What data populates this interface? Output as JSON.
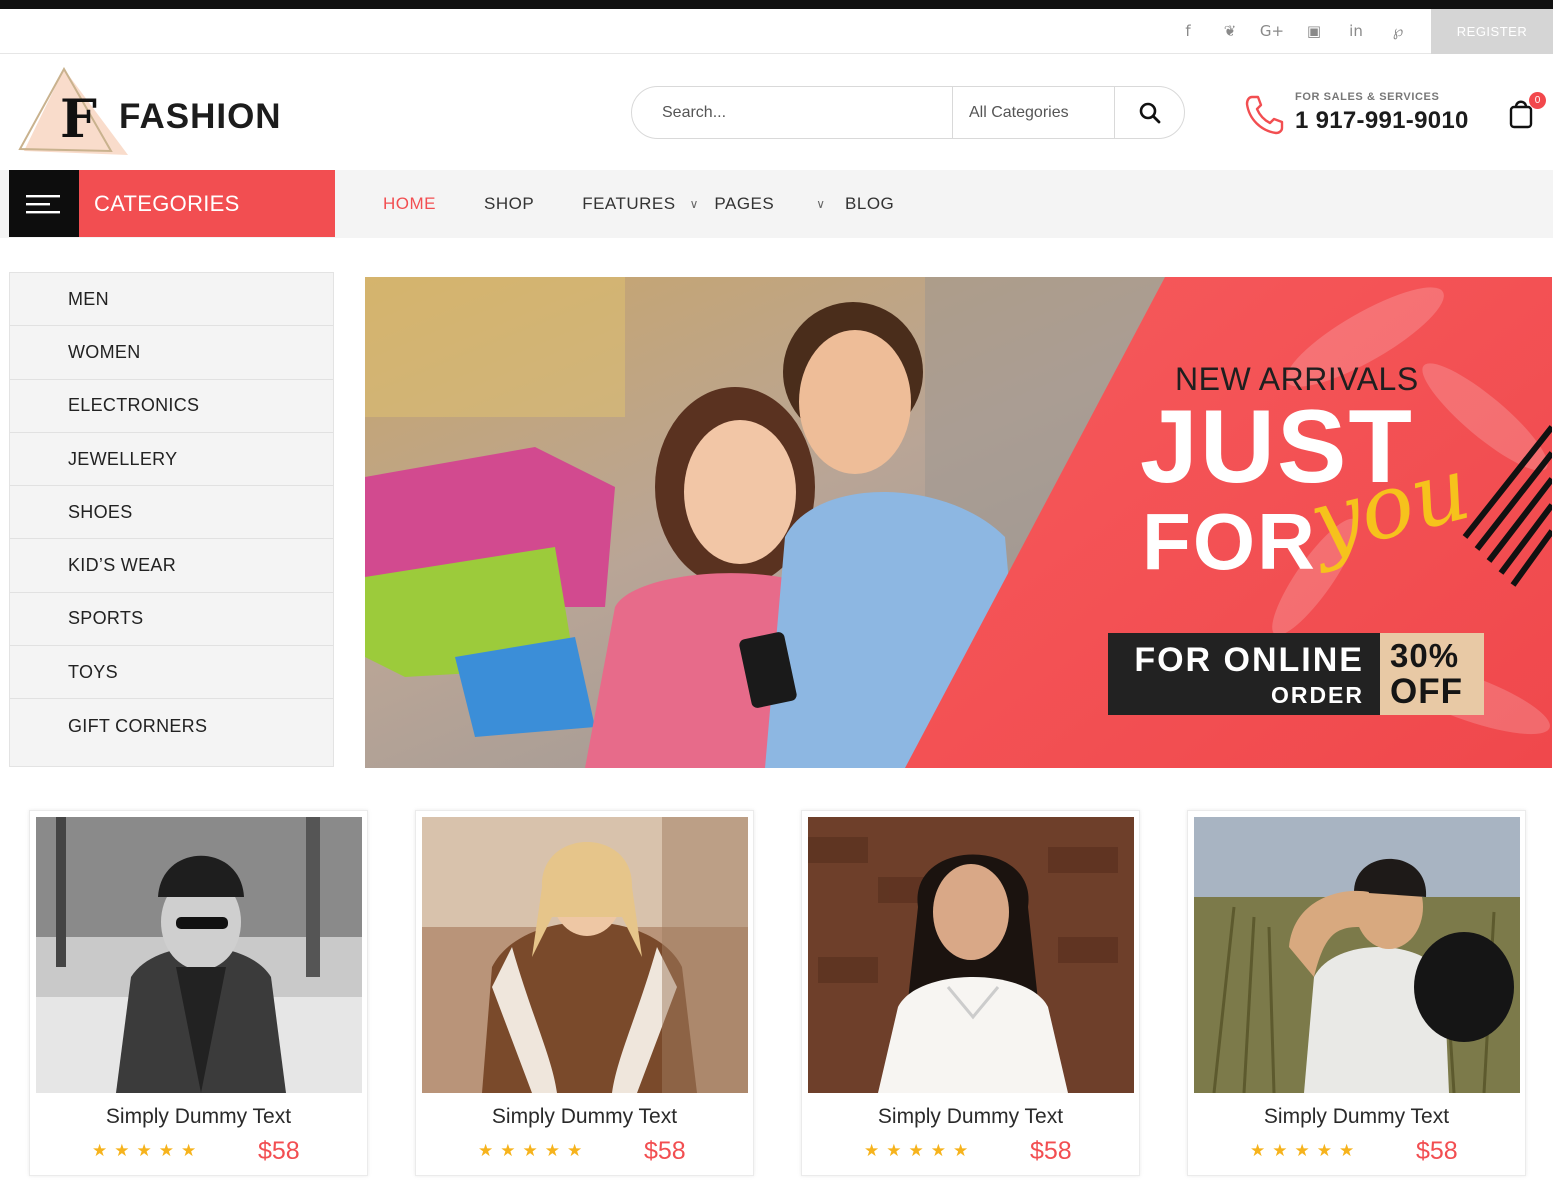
{
  "social": {
    "icons": [
      "facebook-icon",
      "twitter-icon",
      "google-plus-icon",
      "instagram-icon",
      "linkedin-icon",
      "pinterest-icon"
    ],
    "glyphs": [
      "f",
      "❦",
      "G+",
      "▣",
      "in",
      "℘"
    ],
    "register_label": "REGISTER"
  },
  "header": {
    "logo_letter": "F",
    "logo_text": "FASHION",
    "search_placeholder": "Search...",
    "search_category": "All Categories",
    "sales_label": "FOR SALES & SERVICES",
    "sales_phone": "1 917-991-9010",
    "cart_count": "0"
  },
  "nav": {
    "categories_label": "CATEGORIES",
    "items": [
      {
        "label": "HOME",
        "active": true
      },
      {
        "label": "SHOP"
      },
      {
        "label": "FEATURES",
        "dropdown": true
      },
      {
        "label": "PAGES",
        "dropdown": true
      },
      {
        "label": "BLOG"
      }
    ]
  },
  "sidebar": {
    "categories": [
      "MEN",
      "WOMEN",
      "ELECTRONICS",
      "JEWELLERY",
      "SHOES",
      "KID’S WEAR",
      "SPORTS",
      "TOYS",
      "GIFT CORNERS"
    ]
  },
  "hero": {
    "eyebrow": "NEW ARRIVALS",
    "line1": "JUST",
    "line2": "FOR",
    "script": "you",
    "promo_line1": "FOR ONLINE",
    "promo_line2": "ORDER",
    "discount_line1": "30%",
    "discount_line2": "OFF"
  },
  "products": [
    {
      "title": "Simply Dummy Text",
      "price": "$58",
      "rating": 5
    },
    {
      "title": "Simply Dummy Text",
      "price": "$58",
      "rating": 5
    },
    {
      "title": "Simply Dummy Text",
      "price": "$58",
      "rating": 5
    },
    {
      "title": "Simply Dummy Text",
      "price": "$58",
      "rating": 5
    }
  ],
  "colors": {
    "accent": "#f24e51",
    "dark": "#0d0d0d",
    "star": "#f6b31c",
    "script": "#f6c21c"
  }
}
